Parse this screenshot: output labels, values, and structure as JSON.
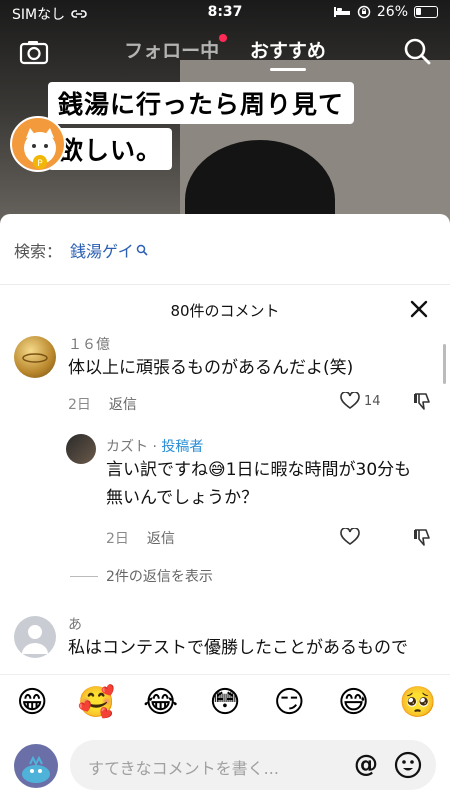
{
  "status_bar": {
    "carrier": "SIMなし",
    "time": "8:37",
    "battery": "26%",
    "battery_level": 0.26
  },
  "top_nav": {
    "tab_following": "フォロー中",
    "tab_recommended": "おすすめ"
  },
  "video": {
    "caption_line1": "銭湯に行ったら周り見て",
    "caption_line2": "欲しい。"
  },
  "search": {
    "label": "検索：",
    "term": "銭湯ゲイ"
  },
  "comments_header": {
    "count_text": "80件のコメント"
  },
  "comments": [
    {
      "username": "１６億",
      "text": "体以上に頑張るものがあるんだよ(笑)",
      "time": "2日",
      "reply_label": "返信",
      "likes": "14"
    },
    {
      "username": "カズト",
      "separator": " · ",
      "author_tag": "投稿者",
      "text_line1": "言い訳ですね😅1日に暇な時間が30分も",
      "text_line2": "無いんでしょうか？",
      "time": "2日",
      "reply_label": "返信"
    },
    {
      "username": "あ",
      "text": "私はコンテストで優勝したことがあるもので"
    }
  ],
  "view_replies": "2件の返信を表示",
  "emoji_bar": [
    "😁",
    "🥰",
    "😂",
    "😳",
    "😏",
    "😅",
    "🥺"
  ],
  "input": {
    "placeholder": "すてきなコメントを書く...",
    "mention_symbol": "@"
  },
  "colors": {
    "author_tag": "#2b8fd6",
    "search_term": "#2b5fb4",
    "notification_dot": "#ff2b55"
  }
}
